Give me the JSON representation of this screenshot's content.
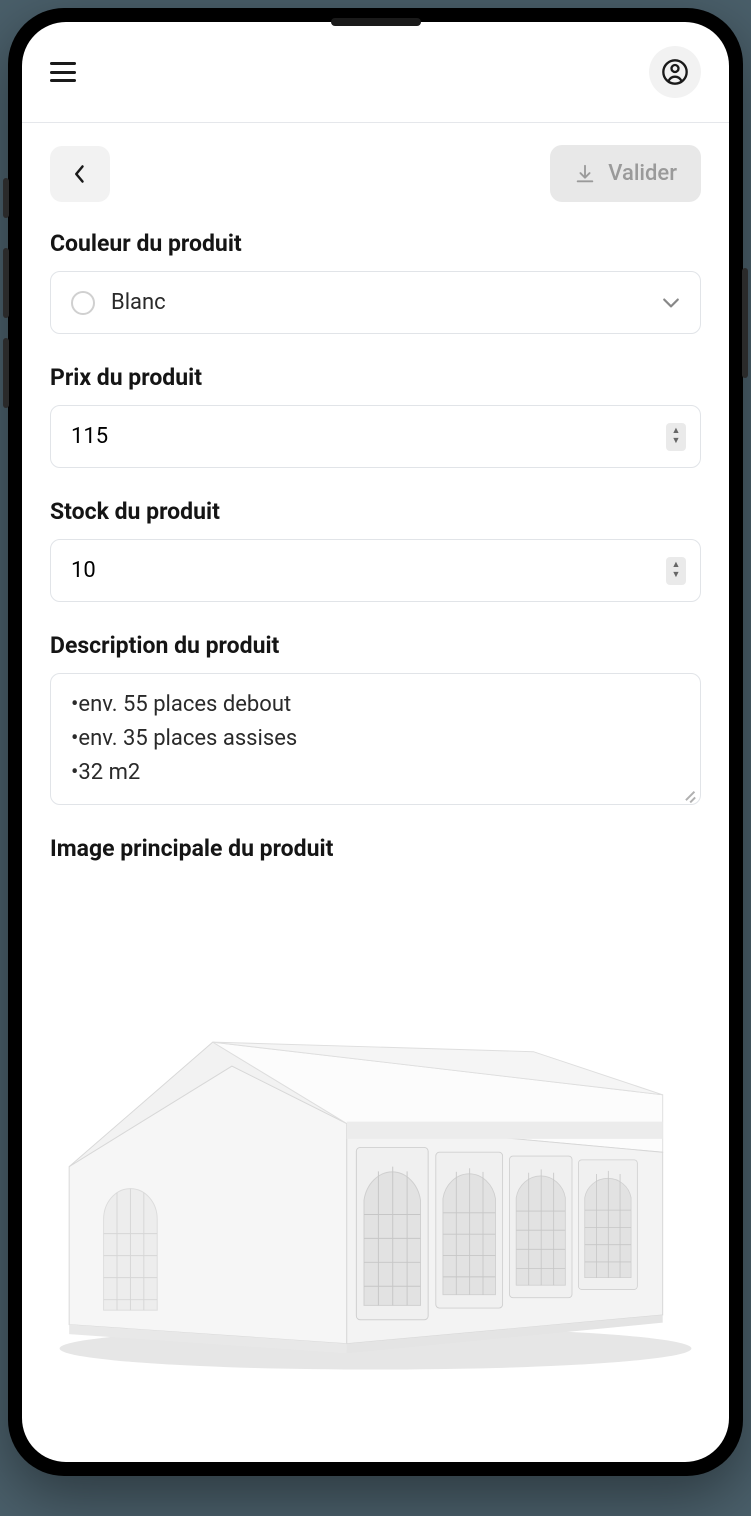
{
  "header": {
    "validate_label": "Valider"
  },
  "fields": {
    "color": {
      "label": "Couleur du produit",
      "value": "Blanc"
    },
    "price": {
      "label": "Prix du produit",
      "value": "115"
    },
    "stock": {
      "label": "Stock du produit",
      "value": "10"
    },
    "description": {
      "label": "Description du produit",
      "lines": [
        "•env. 55 places debout",
        "•env. 35 places assises",
        "•32 m2"
      ]
    },
    "main_image": {
      "label": "Image principale du produit"
    }
  }
}
